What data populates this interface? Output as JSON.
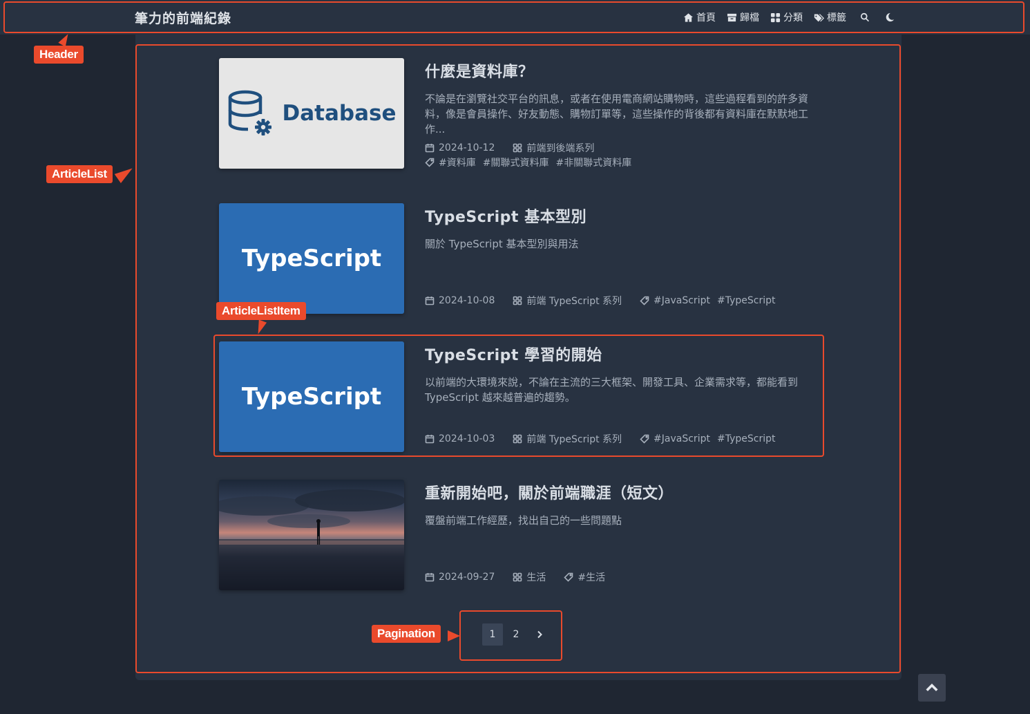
{
  "header": {
    "site_title": "筆力的前端紀錄",
    "nav": [
      {
        "label": "首頁",
        "icon": "home-icon"
      },
      {
        "label": "歸檔",
        "icon": "archive-icon"
      },
      {
        "label": "分類",
        "icon": "grid-icon"
      },
      {
        "label": "標籤",
        "icon": "tags-icon"
      }
    ],
    "search_icon": "search-icon",
    "theme_icon": "moon-icon"
  },
  "annotations": {
    "header": "Header",
    "article_list": "ArticleList",
    "article_list_item": "ArticleListItem",
    "pagination": "Pagination",
    "color": "#ea4a2c"
  },
  "articles": [
    {
      "thumb_text": "Database",
      "title": "什麼是資料庫？",
      "excerpt": "不論是在瀏覽社交平台的訊息，或者在使用電商網站購物時，這些過程看到的許多資料，像是會員操作、好友動態、購物訂單等，這些操作的背後都有資料庫在默默地工作...",
      "date": "2024-10-12",
      "category": "前端到後端系列",
      "tags": [
        "#資料庫",
        "#關聯式資料庫",
        "#非關聯式資料庫"
      ]
    },
    {
      "thumb_text": "TypeScript",
      "title": "TypeScript 基本型別",
      "excerpt": "關於 TypeScript 基本型別與用法",
      "date": "2024-10-08",
      "category": "前端 TypeScript 系列",
      "tags": [
        "#JavaScript",
        "#TypeScript"
      ]
    },
    {
      "thumb_text": "TypeScript",
      "title": "TypeScript 學習的開始",
      "excerpt": "以前端的大環境來說，不論在主流的三大框架、開發工具、企業需求等，都能看到 TypeScript 越來越普遍的趨勢。",
      "date": "2024-10-03",
      "category": "前端 TypeScript 系列",
      "tags": [
        "#JavaScript",
        "#TypeScript"
      ]
    },
    {
      "thumb_text": "",
      "title": "重新開始吧，關於前端職涯（短文）",
      "excerpt": "覆盤前端工作經歷，找出自己的一些問題點",
      "date": "2024-09-27",
      "category": "生活",
      "tags": [
        "#生活"
      ]
    }
  ],
  "pagination": {
    "pages": [
      "1",
      "2"
    ],
    "current": "1",
    "next_icon": "chevron-right-icon"
  },
  "back_to_top_icon": "chevron-up-icon",
  "colors": {
    "background": "#1f2632",
    "panel": "#283241",
    "typescript_blue": "#2b6cb3",
    "database_bg": "#e6e6e6"
  }
}
